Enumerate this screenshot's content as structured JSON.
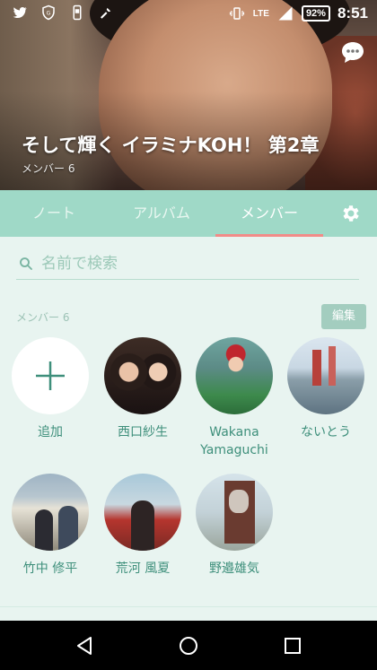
{
  "status_bar": {
    "icons_left": [
      "twitter-icon",
      "shield-icon",
      "phone-icon",
      "tool-icon"
    ],
    "icons_right": [
      "vibrate-icon",
      "lte-icon",
      "signal-icon"
    ],
    "network": "LTE",
    "battery": "92%",
    "time": "8:51"
  },
  "header": {
    "title": "そして輝く イラミナKOH！ 第2章",
    "member_count": "メンバー 6"
  },
  "tabs": [
    {
      "label": "ノート",
      "active": false
    },
    {
      "label": "アルバム",
      "active": false
    },
    {
      "label": "メンバー",
      "active": true
    }
  ],
  "search": {
    "placeholder": "名前で検索",
    "value": ""
  },
  "members_section": {
    "label": "メンバー 6",
    "edit_label": "編集"
  },
  "add": {
    "label": "追加"
  },
  "members": [
    {
      "name": "西口紗生"
    },
    {
      "name": "Wakana\nYamaguchi"
    },
    {
      "name": "ないとう"
    },
    {
      "name": "竹中 修平"
    },
    {
      "name": "荒河 風夏"
    },
    {
      "name": "野邉雄気"
    }
  ],
  "colors": {
    "tab_bar": "#9fd9c7",
    "accent": "#3e8f7b",
    "active_indicator": "#f28b88",
    "background": "#e8f4f0"
  }
}
